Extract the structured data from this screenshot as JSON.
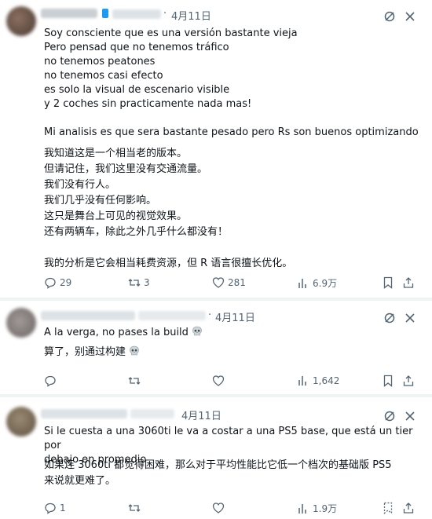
{
  "tweets": [
    {
      "date": "4月11日",
      "text_es": "Soy consciente que es una versión bastante vieja\nPero pensad que no tenemos tráfico\nno tenemos peatones\nno tenemos casi efecto\nes solo la visual de escenario visible\ny 2 coches sin practicamente nada mas!\n\nMi analisis es que sera bastante pesado pero Rs son buenos optimizando",
      "text_cn": "我知道这是一个相当老的版本。\n但请记住，我们这里没有交通流量。\n我们没有行人。\n我们几乎没有任何影响。\n这只是舞台上可见的视觉效果。\n还有两辆车，除此之外几乎什么都没有！\n\n我的分析是它会相当耗费资源，但 R 语言很擅长优化。",
      "replies": "29",
      "retweets": "3",
      "likes": "281",
      "views": "6.9万"
    },
    {
      "date": "4月11日",
      "text_es": "A la verga, no pases la build",
      "text_cn": "算了，别通过构建",
      "replies": "",
      "retweets": "",
      "likes": "",
      "views": "1,642"
    },
    {
      "date": "4月11日",
      "text_es": "Si le cuesta a una 3060ti le va a costar a una PS5 base, que está un tier por\ndebajo en promedio",
      "text_cn": "如果连 3060ti 都觉得困难，那么对于平均性能比它低一个档次的基础版 PS5\n来说就更难了。",
      "replies": "1",
      "retweets": "",
      "likes": "",
      "views": "1.9万"
    }
  ],
  "colors": {
    "text": "#0f1419",
    "muted": "#536471",
    "divider": "#eff3f4",
    "verified": "#1d9bf0"
  },
  "icons": [
    "grok-icon",
    "more-icon",
    "reply-icon",
    "retweet-icon",
    "like-icon",
    "views-icon",
    "bookmark-icon",
    "share-icon",
    "skull-emoji"
  ]
}
